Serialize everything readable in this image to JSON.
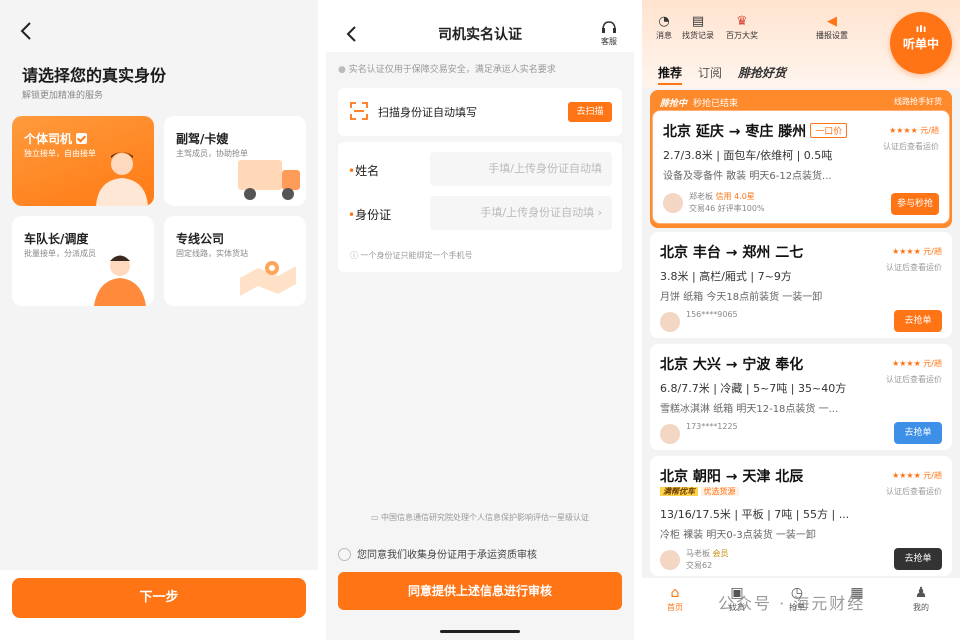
{
  "screen1": {
    "title": "请选择您的真实身份",
    "subtitle": "解锁更加精准的服务",
    "cards": [
      {
        "title": "个体司机",
        "sub": "独立接单，自由接单"
      },
      {
        "title": "副驾/卡嫂",
        "sub": "主驾成员，协助抢单"
      },
      {
        "title": "车队长/调度",
        "sub": "批量接单，分派成员"
      },
      {
        "title": "专线公司",
        "sub": "固定线路，实体货站"
      }
    ],
    "next_label": "下一步"
  },
  "screen2": {
    "title": "司机实名认证",
    "customer_service": "客服",
    "notice": "实名认证仅用于保障交易安全，满足承运人实名要求",
    "scan_label": "扫描身份证自动填写",
    "scan_button": "去扫描",
    "name_label": "姓名",
    "name_placeholder": "手填/上传身份证自动填",
    "id_label": "身份证",
    "id_placeholder": "手填/上传身份证自动填",
    "hint": "一个身份证只能绑定一个手机号",
    "caict": "中国信息通信研究院处理个人信息保护影响评估一星级认证",
    "agree": "您同意我们收集身份证用于承运资质审核",
    "submit": "同意提供上述信息进行审核"
  },
  "screen3": {
    "header_icons": [
      {
        "label": "消息",
        "icon": "bell-icon",
        "glyph": "◔"
      },
      {
        "label": "找货记录",
        "icon": "record-icon",
        "glyph": "▤"
      },
      {
        "label": "百万大奖",
        "icon": "gift-icon",
        "glyph": "♛"
      },
      {
        "label": "播报设置",
        "icon": "speaker-icon",
        "glyph": "◀"
      }
    ],
    "listen_label": "听单中",
    "tabs": [
      "推荐",
      "订阅",
      "腓抢好货"
    ],
    "flash": {
      "badge": "腓抢中",
      "ended": "秒抢已结束",
      "right": "线路抢手好货"
    },
    "orders": [
      {
        "route": "北京 延庆 → 枣庄 滕州",
        "tag": "一口价",
        "line1": "2.7/3.8米 | 面包车/依维柯 | 0.5吨",
        "line2": "设备及零备件 散装 明天6-12点装货...",
        "price": "★★★★ 元/趟",
        "note": "认证后查看运价",
        "user": "郑老板",
        "credit": "信用 4.0星",
        "stats": "交易46 好评率100%",
        "button": "参与秒抢"
      },
      {
        "route": "北京 丰台 → 郑州 二七",
        "line1": "3.8米 | 高栏/厢式 | 7~9方",
        "line2": "月饼 纸箱 今天18点前装货 一装一卸",
        "price": "★★★★ 元/趟",
        "note": "认证后查看运价",
        "user": "156****9065",
        "button": "去抢单"
      },
      {
        "route": "北京 大兴 → 宁波 奉化",
        "line1": "6.8/7.7米 | 冷藏 | 5~7吨 | 35~40方",
        "line2": "雪糕冰淇淋 纸箱 明天12-18点装货 一...",
        "price": "★★★★ 元/趟",
        "note": "认证后查看运价",
        "user": "173****1225",
        "button": "去抢单"
      },
      {
        "route": "北京 朝阳 → 天津 北辰",
        "badge": "满帮优车",
        "badge2": "优选货源",
        "line1": "13/16/17.5米 | 平板 | 7吨 | 55方 | ...",
        "line2": "冷柜 裸装 明天0-3点装货 一装一卸",
        "price": "★★★★ 元/趟",
        "note": "认证后查看运价",
        "user": "马老板",
        "member": "会员",
        "stats": "交易62",
        "button": "去抢单"
      }
    ],
    "tabbar": [
      "首页",
      "找货",
      "抢单",
      "我的"
    ],
    "watermark": "公众号 · 海元财经"
  },
  "colors": {
    "accent": "#ff7414",
    "blue": "#3d8fe8",
    "dark": "#333333"
  }
}
